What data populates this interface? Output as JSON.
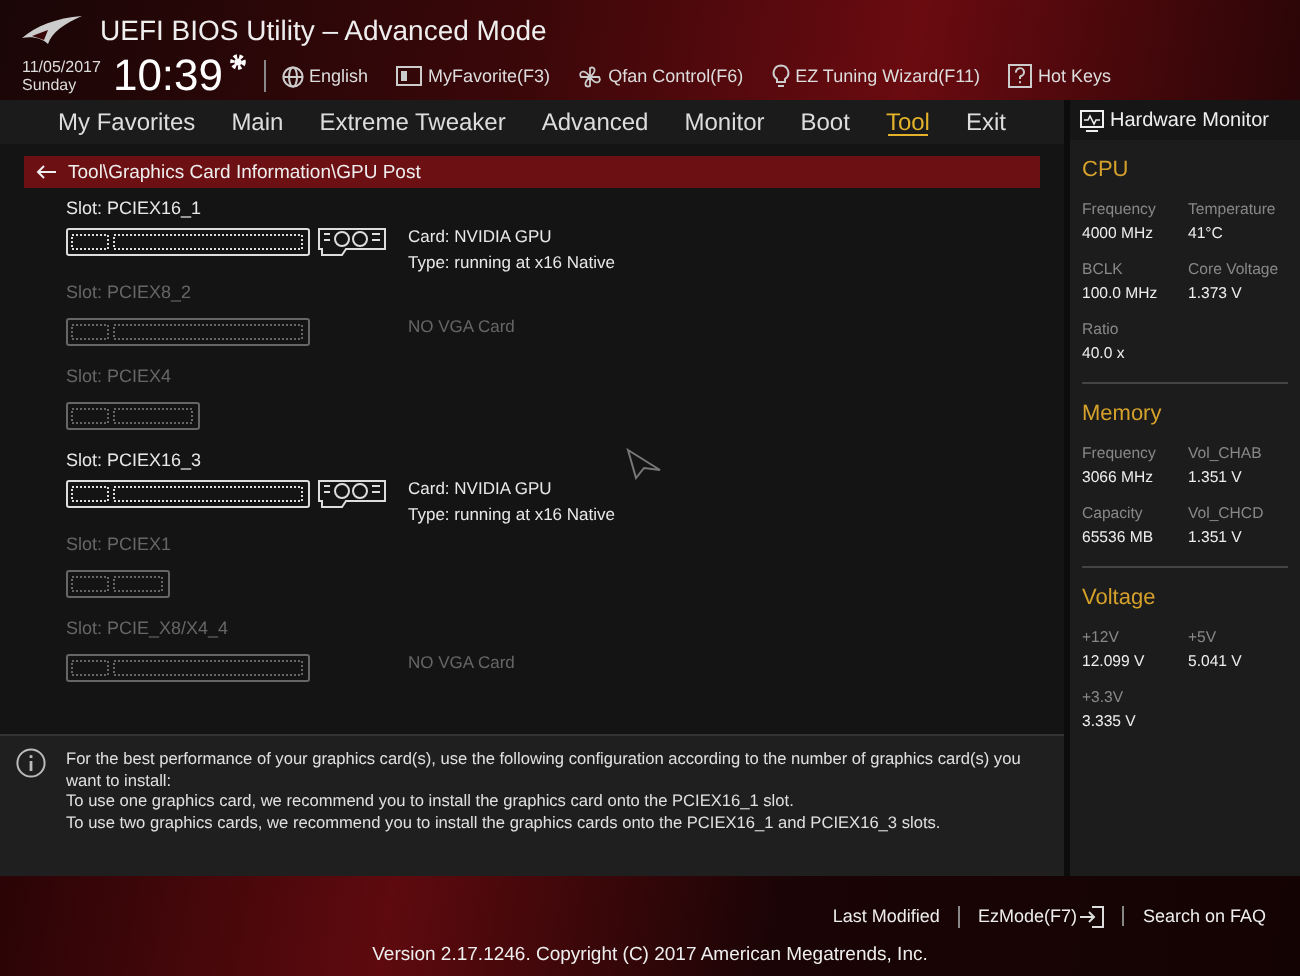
{
  "header": {
    "title": "UEFI BIOS Utility – Advanced Mode",
    "date": "11/05/2017",
    "day": "Sunday",
    "time": "10:39",
    "tools": [
      {
        "kind": "globe",
        "label": "English"
      },
      {
        "kind": "screen",
        "label": "MyFavorite(F3)"
      },
      {
        "kind": "fan",
        "label": "Qfan Control(F6)"
      },
      {
        "kind": "bulb",
        "label": "EZ Tuning Wizard(F11)"
      },
      {
        "kind": "help",
        "label": "Hot Keys"
      }
    ]
  },
  "tabs": [
    {
      "label": "My Favorites",
      "selected": false
    },
    {
      "label": "Main",
      "selected": false
    },
    {
      "label": "Extreme Tweaker",
      "selected": false
    },
    {
      "label": "Advanced",
      "selected": false
    },
    {
      "label": "Monitor",
      "selected": false
    },
    {
      "label": "Boot",
      "selected": false
    },
    {
      "label": "Tool",
      "selected": true
    },
    {
      "label": "Exit",
      "selected": false
    }
  ],
  "breadcrumb": "Tool\\Graphics Card Information\\GPU Post",
  "slots": [
    {
      "name": "Slot: PCIEX16_1",
      "kind": "long",
      "populated": true,
      "lines": [
        "Card: NVIDIA GPU",
        "Type: running at x16 Native"
      ]
    },
    {
      "name": "Slot: PCIEX8_2",
      "kind": "long",
      "populated": false,
      "lines": [
        "NO VGA Card"
      ]
    },
    {
      "name": "Slot: PCIEX4",
      "kind": "medium",
      "populated": false
    },
    {
      "name": "Slot: PCIEX16_3",
      "kind": "long",
      "populated": true,
      "lines": [
        "Card: NVIDIA GPU",
        "Type: running at x16 Native"
      ]
    },
    {
      "name": "Slot: PCIEX1",
      "kind": "short",
      "populated": false
    },
    {
      "name": "Slot: PCIE_X8/X4_4",
      "kind": "long",
      "populated": false,
      "lines": [
        "NO VGA Card"
      ]
    }
  ],
  "info": [
    "For the best performance of your graphics card(s), use the following configuration according to the number of graphics card(s) you want to install:",
    "To use one graphics card, we recommend you to install  the graphics card onto the PCIEX16_1 slot.",
    "To use two graphics cards, we recommend you to install the graphics cards onto the PCIEX16_1 and PCIEX16_3 slots."
  ],
  "hardware_monitor": {
    "title": "Hardware Monitor",
    "sections": [
      {
        "title": "CPU",
        "items": [
          {
            "label": "Frequency",
            "value": "4000 MHz"
          },
          {
            "label": "Temperature",
            "value": "41°C"
          },
          {
            "label": "BCLK",
            "value": "100.0 MHz"
          },
          {
            "label": "Core Voltage",
            "value": "1.373 V"
          },
          {
            "label": "Ratio",
            "value": "40.0 x"
          }
        ]
      },
      {
        "title": "Memory",
        "items": [
          {
            "label": "Frequency",
            "value": "3066 MHz"
          },
          {
            "label": "Vol_CHAB",
            "value": "1.351 V"
          },
          {
            "label": "Capacity",
            "value": "65536 MB"
          },
          {
            "label": "Vol_CHCD",
            "value": "1.351 V"
          }
        ]
      },
      {
        "title": "Voltage",
        "items": [
          {
            "label": "+12V",
            "value": "12.099 V"
          },
          {
            "label": "+5V",
            "value": "5.041 V"
          },
          {
            "label": "+3.3V",
            "value": "3.335 V"
          }
        ]
      }
    ]
  },
  "footer": {
    "links": [
      {
        "kind": "plain",
        "label": "Last Modified"
      },
      {
        "kind": "exit",
        "label": "EzMode(F7)"
      },
      {
        "kind": "plain",
        "label": "Search on FAQ"
      }
    ],
    "version": "Version 2.17.1246. Copyright (C) 2017 American Megatrends, Inc."
  }
}
